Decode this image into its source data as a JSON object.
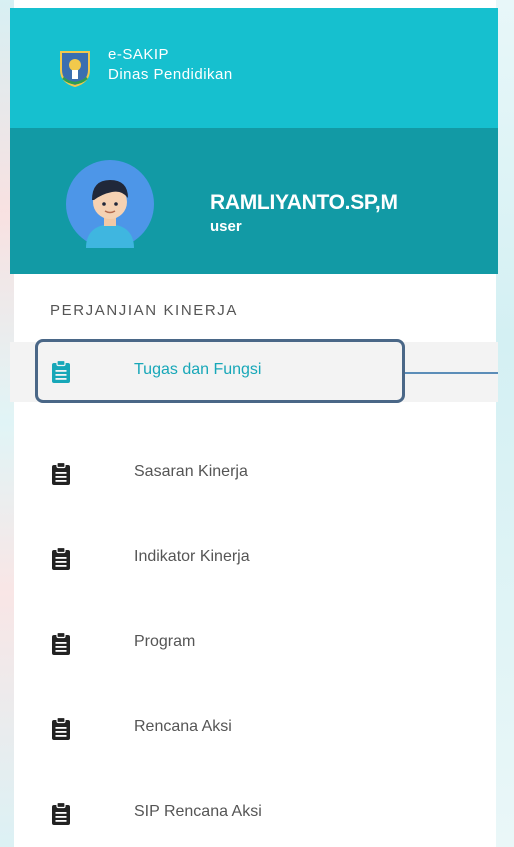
{
  "brand": {
    "title": "e-SAKIP",
    "subtitle": "Dinas Pendidikan",
    "primary_color": "#16c0cf",
    "logo_icon": "emblem-icon"
  },
  "user": {
    "name": "RAMLIYANTO.SP,M",
    "role": "user",
    "panel_color": "#129aa5",
    "avatar_icon": "avatar-icon"
  },
  "sidebar": {
    "section_title": "PERJANJIAN KINERJA",
    "active_color": "#17a7b8",
    "items": [
      {
        "label": "Tugas dan Fungsi",
        "icon": "clipboard-icon",
        "active": true
      },
      {
        "label": "Sasaran Kinerja",
        "icon": "clipboard-icon",
        "active": false
      },
      {
        "label": "Indikator Kinerja",
        "icon": "clipboard-icon",
        "active": false
      },
      {
        "label": "Program",
        "icon": "clipboard-icon",
        "active": false
      },
      {
        "label": "Rencana Aksi",
        "icon": "clipboard-icon",
        "active": false
      },
      {
        "label": "SIP Rencana Aksi",
        "icon": "clipboard-icon",
        "active": false
      }
    ]
  }
}
